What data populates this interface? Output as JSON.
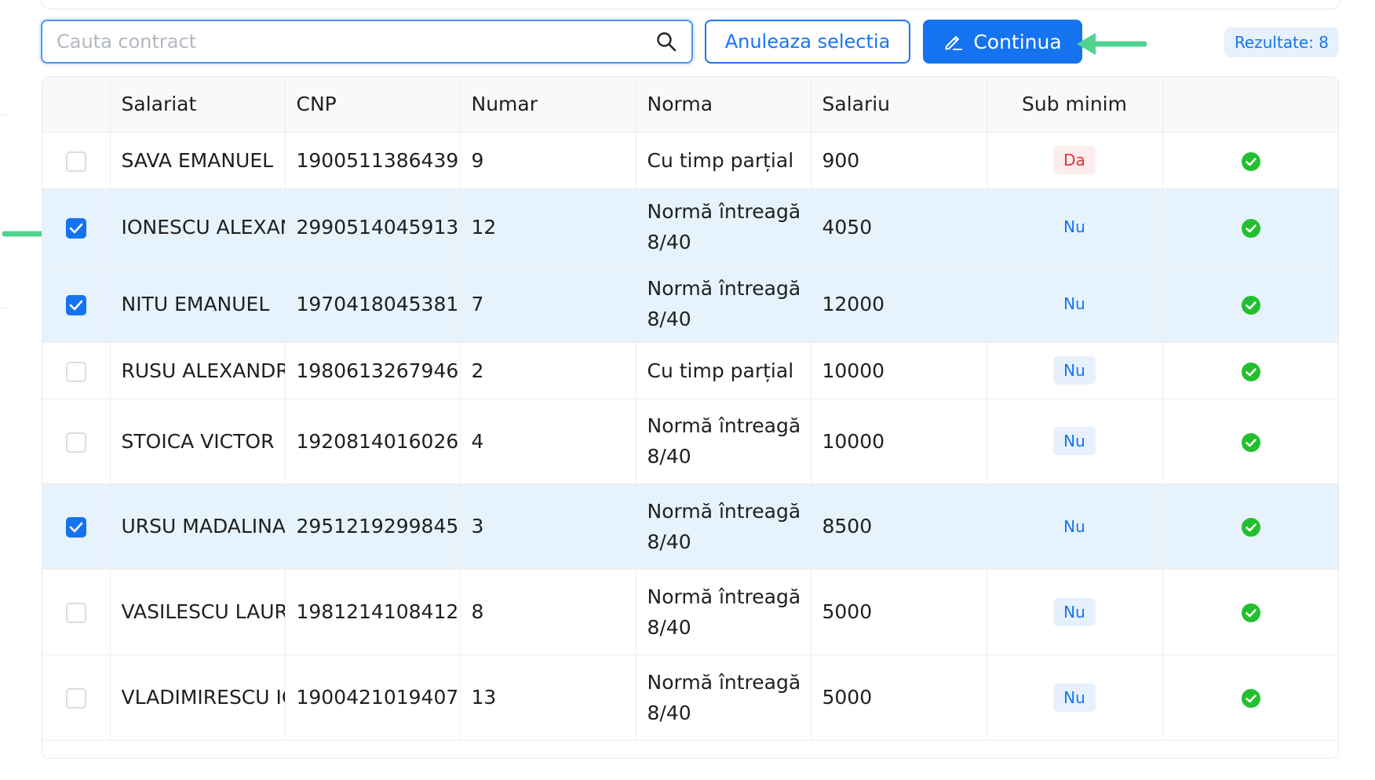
{
  "toolbar": {
    "search_placeholder": "Cauta contract",
    "search_value": "",
    "cancel_label": "Anuleaza selectia",
    "continue_label": "Continua",
    "results_label": "Rezultate: 8"
  },
  "table": {
    "columns": [
      "",
      "Salariat",
      "CNP",
      "Numar",
      "Norma",
      "Salariu",
      "Sub minim",
      ""
    ],
    "rows": [
      {
        "checked": false,
        "salariat": "SAVA EMANUEL",
        "cnp": "1900511386439",
        "numar": "9",
        "norma_l1": "Cu timp parțial",
        "norma_l2": "",
        "salariu": "900",
        "sub_minim": "Da"
      },
      {
        "checked": true,
        "salariat": "IONESCU ALEXAN",
        "cnp": "2990514045913",
        "numar": "12",
        "norma_l1": "Normă întreagă",
        "norma_l2": "8/40",
        "salariu": "4050",
        "sub_minim": "Nu"
      },
      {
        "checked": true,
        "salariat": "NITU EMANUEL",
        "cnp": "1970418045381",
        "numar": "7",
        "norma_l1": "Normă întreagă",
        "norma_l2": "8/40",
        "salariu": "12000",
        "sub_minim": "Nu"
      },
      {
        "checked": false,
        "salariat": "RUSU ALEXANDRU",
        "cnp": "1980613267946",
        "numar": "2",
        "norma_l1": "Cu timp parțial",
        "norma_l2": "",
        "salariu": "10000",
        "sub_minim": "Nu"
      },
      {
        "checked": false,
        "salariat": "STOICA VICTOR",
        "cnp": "1920814016026",
        "numar": "4",
        "norma_l1": "Normă întreagă",
        "norma_l2": "8/40",
        "salariu": "10000",
        "sub_minim": "Nu"
      },
      {
        "checked": true,
        "salariat": "URSU MADALINA",
        "cnp": "2951219299845",
        "numar": "3",
        "norma_l1": "Normă întreagă",
        "norma_l2": "8/40",
        "salariu": "8500",
        "sub_minim": "Nu"
      },
      {
        "checked": false,
        "salariat": "VASILESCU LAUR",
        "cnp": "1981214108412",
        "numar": "8",
        "norma_l1": "Normă întreagă",
        "norma_l2": "8/40",
        "salariu": "5000",
        "sub_minim": "Nu"
      },
      {
        "checked": false,
        "salariat": "VLADIMIRESCU IC",
        "cnp": "1900421019407",
        "numar": "13",
        "norma_l1": "Normă întreagă",
        "norma_l2": "8/40",
        "salariu": "5000",
        "sub_minim": "Nu"
      }
    ]
  },
  "icons": {
    "search": "search-icon",
    "edit": "pencil-icon",
    "status": "check-circle-icon",
    "arrow": "arrow-pointer-icon"
  },
  "colors": {
    "primary": "#1573f0",
    "selected_row": "#e6f3fd",
    "success": "#22c02e",
    "danger": "#e0323b",
    "arrow": "#4fd38f"
  }
}
